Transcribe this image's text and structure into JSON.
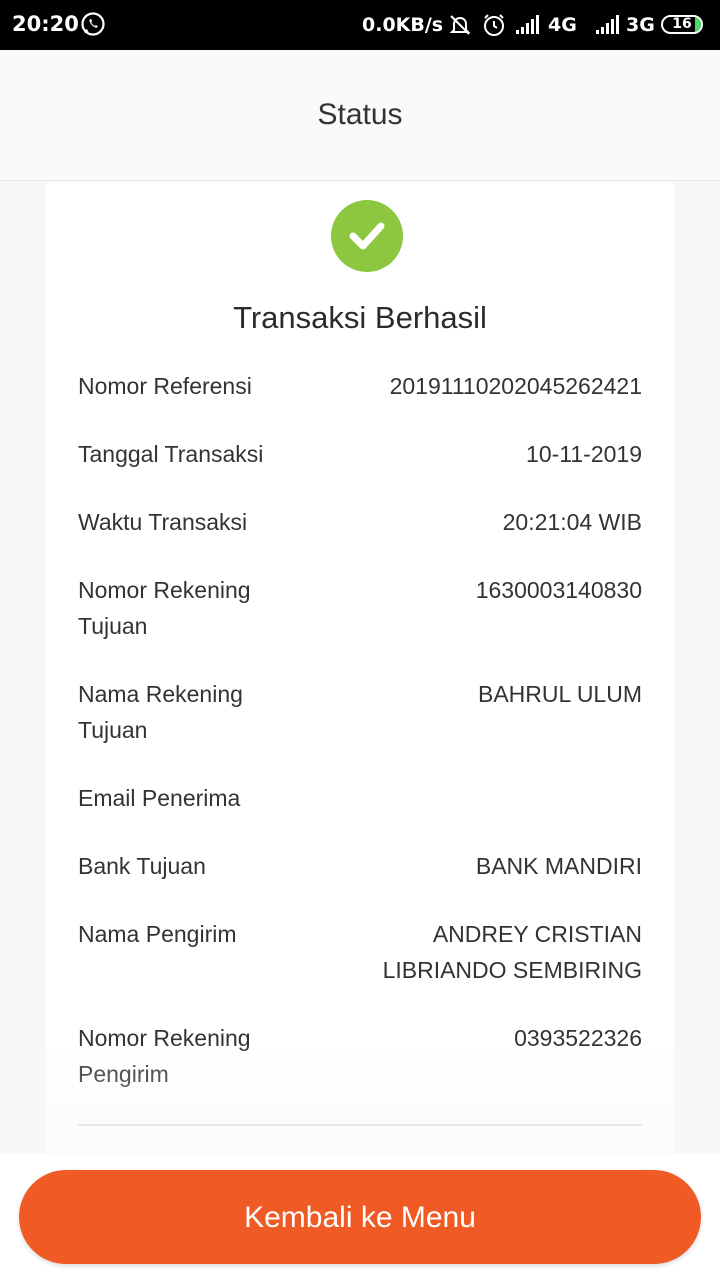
{
  "status_bar": {
    "time": "20:20",
    "speed": "0.0KB/s",
    "net1": "4G",
    "net2": "3G",
    "battery": "16",
    "battery_level": 0.16
  },
  "header": {
    "title": "Status"
  },
  "result": {
    "icon": "check-icon",
    "title": "Transaksi Berhasil",
    "accent_color": "#8dc63f"
  },
  "details": [
    {
      "label": "Nomor Referensi",
      "value": "20191110202045262421"
    },
    {
      "label": "Tanggal Transaksi",
      "value": "10-11-2019"
    },
    {
      "label": "Waktu Transaksi",
      "value": "20:21:04 WIB"
    },
    {
      "label": "Nomor Rekening Tujuan",
      "value": "1630003140830"
    },
    {
      "label": "Nama Rekening Tujuan",
      "value": "BAHRUL ULUM"
    },
    {
      "label": "Email Penerima",
      "value": ""
    },
    {
      "label": "Bank Tujuan",
      "value": "BANK MANDIRI"
    },
    {
      "label": "Nama Pengirim",
      "value": "ANDREY CRISTIAN LIBRIANDO SEMBIRING"
    },
    {
      "label": "Nomor Rekening Pengirim",
      "value": "0393522326"
    }
  ],
  "actions": {
    "back_label": "Kembali ke Menu",
    "back_color": "#f05a24"
  }
}
